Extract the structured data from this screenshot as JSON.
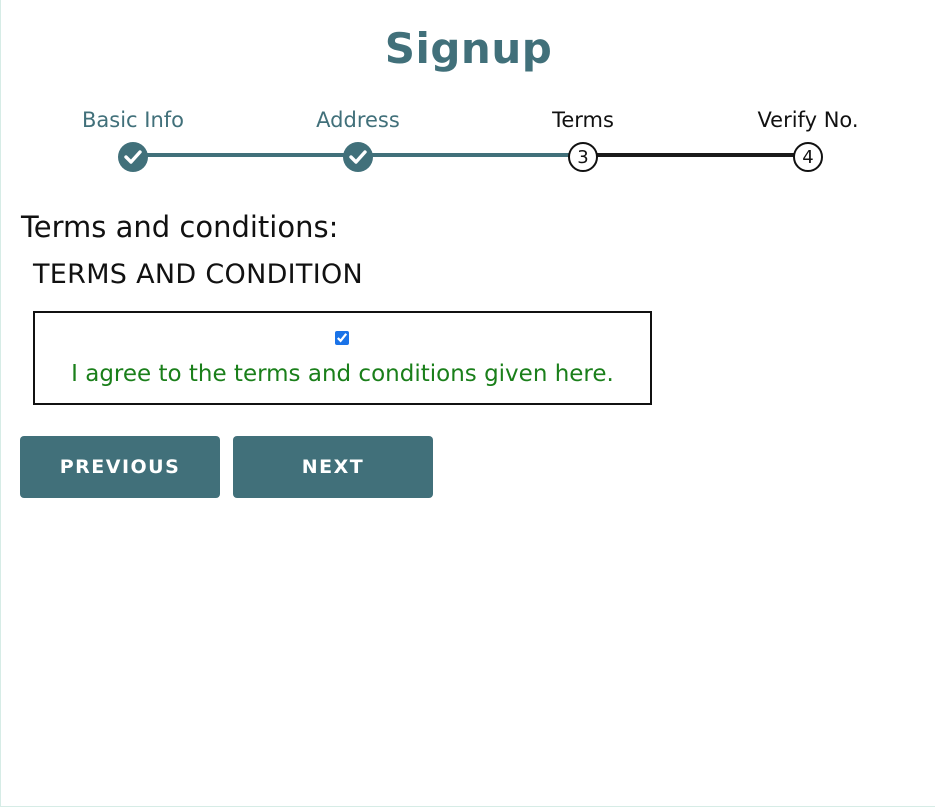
{
  "form": {
    "title": "Signup",
    "steps": [
      {
        "label": "Basic Info",
        "state": "done"
      },
      {
        "label": "Address",
        "state": "done"
      },
      {
        "label": "Terms",
        "state": "current",
        "number": "3"
      },
      {
        "label": "Verify No.",
        "state": "todo",
        "number": "4"
      }
    ],
    "section_title": "Terms and conditions:",
    "terms_heading": "TERMS AND CONDITION",
    "agree_checked": true,
    "agree_text": "I agree to the terms and conditions given here.",
    "previous_label": "PREVIOUS",
    "next_label": "NEXT"
  },
  "colors": {
    "accent": "#41707a",
    "agree_text": "#1a7f1a",
    "checkbox": "#1a73e8"
  },
  "icons": {
    "completed_step": "check-icon"
  }
}
